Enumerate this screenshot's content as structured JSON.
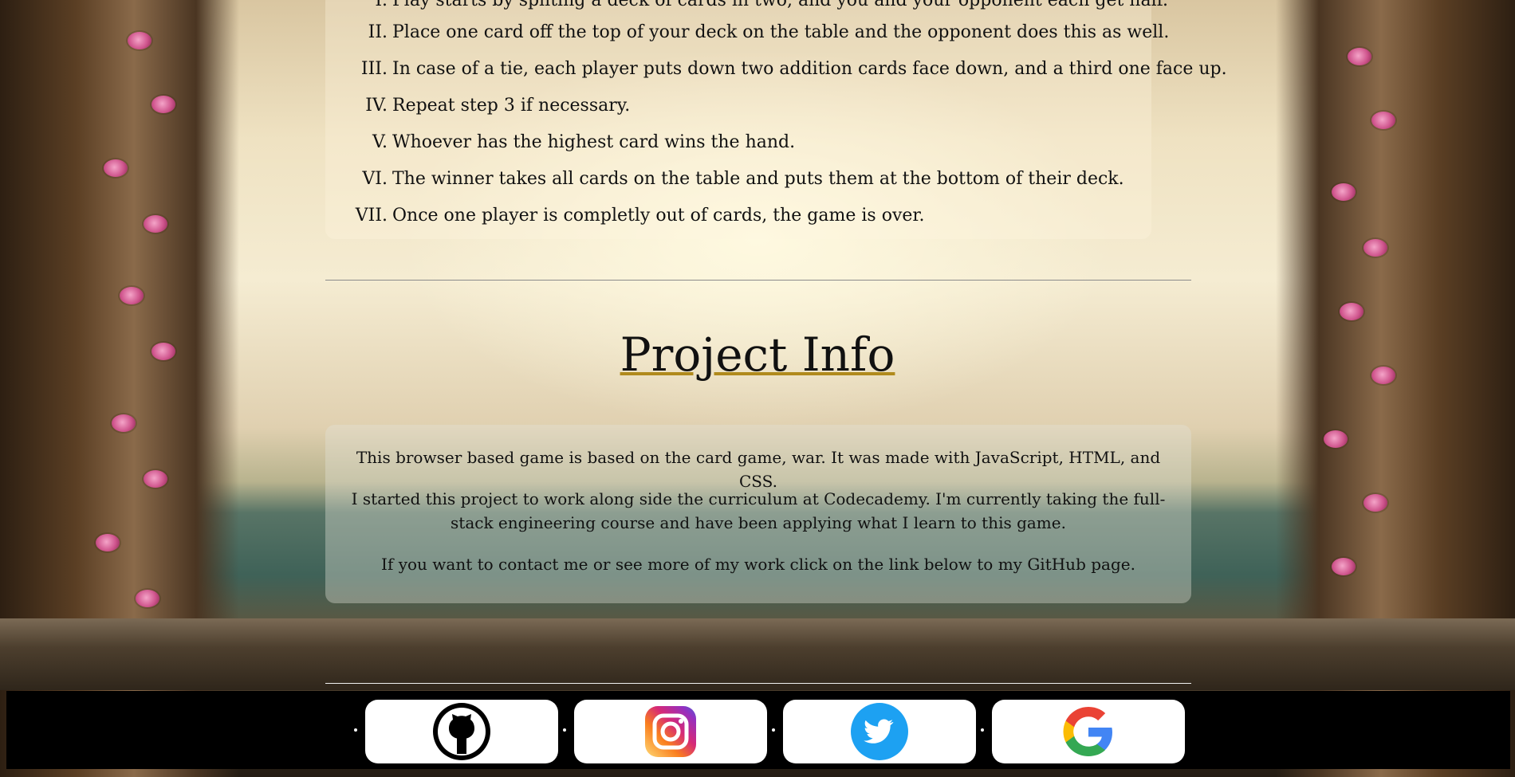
{
  "rules": [
    {
      "numeral": "I.",
      "text": "Play starts by spliting a deck of cards in two, and you and your opponent each get half."
    },
    {
      "numeral": "II.",
      "text": "Place one card off the top of your deck on the table and the opponent does this as well."
    },
    {
      "numeral": "III.",
      "text": "In case of a tie, each player puts down two addition cards face down, and a third one face up."
    },
    {
      "numeral": "IV.",
      "text": "Repeat step 3 if necessary."
    },
    {
      "numeral": "V.",
      "text": "Whoever has the highest card wins the hand."
    },
    {
      "numeral": "VI.",
      "text": "The winner takes all cards on the table and puts them at the bottom of their deck."
    },
    {
      "numeral": "VII.",
      "text": "Once one player is completly out of cards, the game is over."
    }
  ],
  "project_info": {
    "title": "Project Info",
    "paragraphs": [
      "This browser based game is based on the card game, war. It was made with JavaScript, HTML, and CSS.",
      "I started this project to work along side the curriculum at Codecademy. I'm currently taking the full-stack engineering course and have been applying what I learn to this game.",
      "If you want to contact me or see more of my work click on the link below to my GitHub page."
    ]
  },
  "footer": {
    "links": [
      {
        "name": "GitHub",
        "icon": "github-icon"
      },
      {
        "name": "Instagram",
        "icon": "instagram-icon"
      },
      {
        "name": "Twitter",
        "icon": "twitter-icon"
      },
      {
        "name": "Google",
        "icon": "google-icon"
      }
    ]
  },
  "colors": {
    "title_underline": "#b08a1c",
    "footer_bg": "#000000",
    "twitter_blue": "#1da1f2"
  }
}
